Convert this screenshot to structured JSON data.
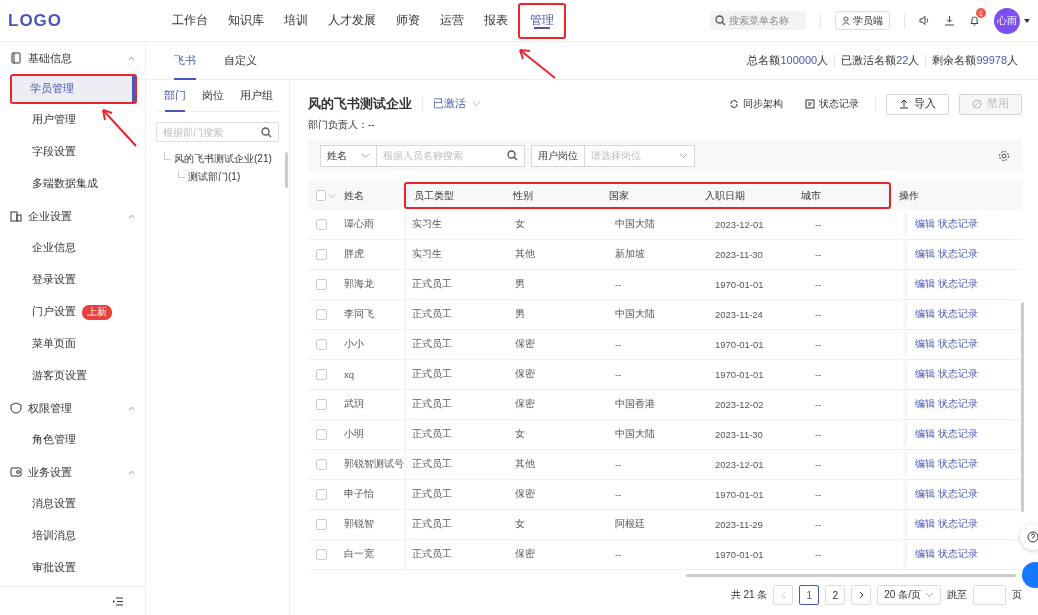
{
  "header": {
    "logo": "LOGO",
    "nav": [
      {
        "label": "工作台",
        "selected": false,
        "annotated": false
      },
      {
        "label": "知识库",
        "selected": false,
        "annotated": false
      },
      {
        "label": "培训",
        "selected": false,
        "annotated": false
      },
      {
        "label": "人才发展",
        "selected": false,
        "annotated": false
      },
      {
        "label": "师资",
        "selected": false,
        "annotated": false
      },
      {
        "label": "运营",
        "selected": false,
        "annotated": false
      },
      {
        "label": "报表",
        "selected": false,
        "annotated": false
      },
      {
        "label": "管理",
        "selected": true,
        "annotated": true
      }
    ],
    "search": {
      "placeholder": "搜索菜单名称"
    },
    "student_button": "学员端",
    "notification_badge": "1",
    "avatar": "心雨"
  },
  "sidebar": {
    "groups": [
      {
        "label": "基础信息",
        "expanded": true,
        "children": [
          {
            "label": "学员管理",
            "selected": true,
            "annotated": true
          },
          {
            "label": "用户管理",
            "selected": false,
            "annotated": false
          },
          {
            "label": "字段设置",
            "selected": false,
            "annotated": false
          },
          {
            "label": "多端数据集成",
            "selected": false,
            "annotated": false
          }
        ]
      },
      {
        "label": "企业设置",
        "expanded": true,
        "children": [
          {
            "label": "企业信息",
            "selected": false,
            "annotated": false
          },
          {
            "label": "登录设置",
            "selected": false,
            "annotated": false
          },
          {
            "label": "门户设置",
            "selected": false,
            "annotated": false,
            "badge": "上新"
          },
          {
            "label": "菜单页面",
            "selected": false,
            "annotated": false
          },
          {
            "label": "游客页设置",
            "selected": false,
            "annotated": false
          }
        ]
      },
      {
        "label": "权限管理",
        "expanded": true,
        "children": [
          {
            "label": "角色管理",
            "selected": false,
            "annotated": false
          }
        ]
      },
      {
        "label": "业务设置",
        "expanded": true,
        "children": [
          {
            "label": "消息设置",
            "selected": false,
            "annotated": false
          },
          {
            "label": "培训消息",
            "selected": false,
            "annotated": false
          },
          {
            "label": "审批设置",
            "selected": false,
            "annotated": false
          }
        ]
      }
    ]
  },
  "source_tabs": [
    {
      "label": "飞书",
      "selected": true
    },
    {
      "label": "自定义",
      "selected": false
    }
  ],
  "quota": [
    {
      "label": "总名额",
      "value": "100000",
      "unit": "人"
    },
    {
      "label": "已激活名额",
      "value": "22",
      "unit": "人"
    },
    {
      "label": "剩余名额",
      "value": "99978",
      "unit": "人"
    }
  ],
  "org_pane": {
    "tabs": [
      {
        "label": "部门",
        "selected": true
      },
      {
        "label": "岗位",
        "selected": false
      },
      {
        "label": "用户组",
        "selected": false
      }
    ],
    "search": {
      "placeholder": "根据部门搜索"
    },
    "tree": [
      {
        "label": "风的飞书测试企业(21)",
        "children": [
          {
            "label": "测试部门(1)"
          }
        ]
      }
    ]
  },
  "company": {
    "title": "风的飞书测试企业",
    "status": "已激活",
    "manager_label": "部门负责人：",
    "manager": "--",
    "actions": [
      {
        "label": "同步架构"
      },
      {
        "label": "状态记录"
      }
    ],
    "buttons": [
      {
        "label": "导入",
        "disabled": false
      },
      {
        "label": "禁用",
        "disabled": true
      }
    ]
  },
  "filters": [
    {
      "kind": "search",
      "select": "姓名",
      "placeholder": "根据人员名称搜索"
    },
    {
      "kind": "select",
      "label": "用户岗位",
      "placeholder": "请选择岗位"
    }
  ],
  "table": {
    "all_checked": false,
    "columns": [
      {
        "label": "姓名",
        "annotated": false
      },
      {
        "label": "员工类型",
        "annotated": true
      },
      {
        "label": "性别",
        "annotated": true
      },
      {
        "label": "国家",
        "annotated": true
      },
      {
        "label": "入职日期",
        "annotated": true
      },
      {
        "label": "城市",
        "annotated": true
      },
      {
        "label": "操作",
        "annotated": false
      }
    ],
    "rows": [
      {
        "cells": [
          "谭心雨",
          "实习生",
          "女",
          "中国大陆",
          "2023-12-01",
          "--"
        ],
        "actions": [
          "编辑",
          "状态记录"
        ],
        "checked": false
      },
      {
        "cells": [
          "胖虎",
          "实习生",
          "其他",
          "新加坡",
          "2023-11-30",
          "--"
        ],
        "actions": [
          "编辑",
          "状态记录"
        ],
        "checked": false
      },
      {
        "cells": [
          "郭海龙",
          "正式员工",
          "男",
          "--",
          "1970-01-01",
          "--"
        ],
        "actions": [
          "编辑",
          "状态记录"
        ],
        "checked": false
      },
      {
        "cells": [
          "李同飞",
          "正式员工",
          "男",
          "中国大陆",
          "2023-11-24",
          "--"
        ],
        "actions": [
          "编辑",
          "状态记录"
        ],
        "checked": false
      },
      {
        "cells": [
          "小小",
          "正式员工",
          "保密",
          "--",
          "1970-01-01",
          "--"
        ],
        "actions": [
          "编辑",
          "状态记录"
        ],
        "checked": false
      },
      {
        "cells": [
          "xq",
          "正式员工",
          "保密",
          "--",
          "1970-01-01",
          "--"
        ],
        "actions": [
          "编辑",
          "状态记录"
        ],
        "checked": false
      },
      {
        "cells": [
          "武玥",
          "正式员工",
          "保密",
          "中国香港",
          "2023-12-02",
          "--"
        ],
        "actions": [
          "编辑",
          "状态记录"
        ],
        "checked": false
      },
      {
        "cells": [
          "小明",
          "正式员工",
          "女",
          "中国大陆",
          "2023-11-30",
          "--"
        ],
        "actions": [
          "编辑",
          "状态记录"
        ],
        "checked": false
      },
      {
        "cells": [
          "郭锐智测试号",
          "正式员工",
          "其他",
          "--",
          "2023-12-01",
          "--"
        ],
        "actions": [
          "编辑",
          "状态记录"
        ],
        "checked": false
      },
      {
        "cells": [
          "申子怡",
          "正式员工",
          "保密",
          "--",
          "1970-01-01",
          "--"
        ],
        "actions": [
          "编辑",
          "状态记录"
        ],
        "checked": false
      },
      {
        "cells": [
          "郭锐智",
          "正式员工",
          "女",
          "阿根廷",
          "2023-11-29",
          "--"
        ],
        "actions": [
          "编辑",
          "状态记录"
        ],
        "checked": false
      },
      {
        "cells": [
          "白一宽",
          "正式员工",
          "保密",
          "--",
          "1970-01-01",
          "--"
        ],
        "actions": [
          "编辑",
          "状态记录"
        ],
        "checked": false
      }
    ]
  },
  "pagination": {
    "total": "共 21 条",
    "pages": [
      {
        "label": "1",
        "selected": true
      },
      {
        "label": "2",
        "selected": false
      }
    ],
    "page_size": "20 条/页",
    "jump_label": "跳至",
    "jump_unit": "页"
  }
}
